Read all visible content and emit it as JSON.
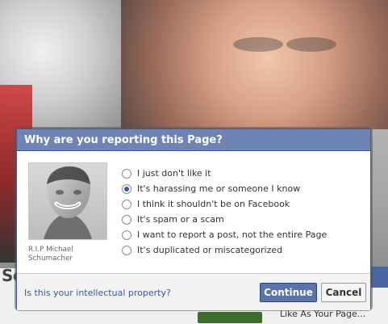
{
  "dialog": {
    "title": "Why are you reporting this Page?",
    "profile": {
      "caption_line1": "R.I.P Michael",
      "caption_line2": "Schumacher"
    },
    "options": [
      {
        "label": "I just don't like it",
        "selected": false
      },
      {
        "label": "It's harassing me or someone I know",
        "selected": true
      },
      {
        "label": "I think it shouldn't be on Facebook",
        "selected": false
      },
      {
        "label": "It's spam or a scam",
        "selected": false
      },
      {
        "label": "I want to report a post, not the entire Page",
        "selected": false
      },
      {
        "label": "It's duplicated or miscategorized",
        "selected": false
      }
    ],
    "footer": {
      "link_text": "Is this your intellectual property?",
      "continue_label": "Continue",
      "cancel_label": "Cancel"
    }
  },
  "background": {
    "partial_heading": "Sc",
    "right_snippet": "Like As Your Page..."
  },
  "colors": {
    "fb_blue": "#3b5998",
    "header_blue": "#6d84b4",
    "primary_button": "#5b74a8"
  }
}
